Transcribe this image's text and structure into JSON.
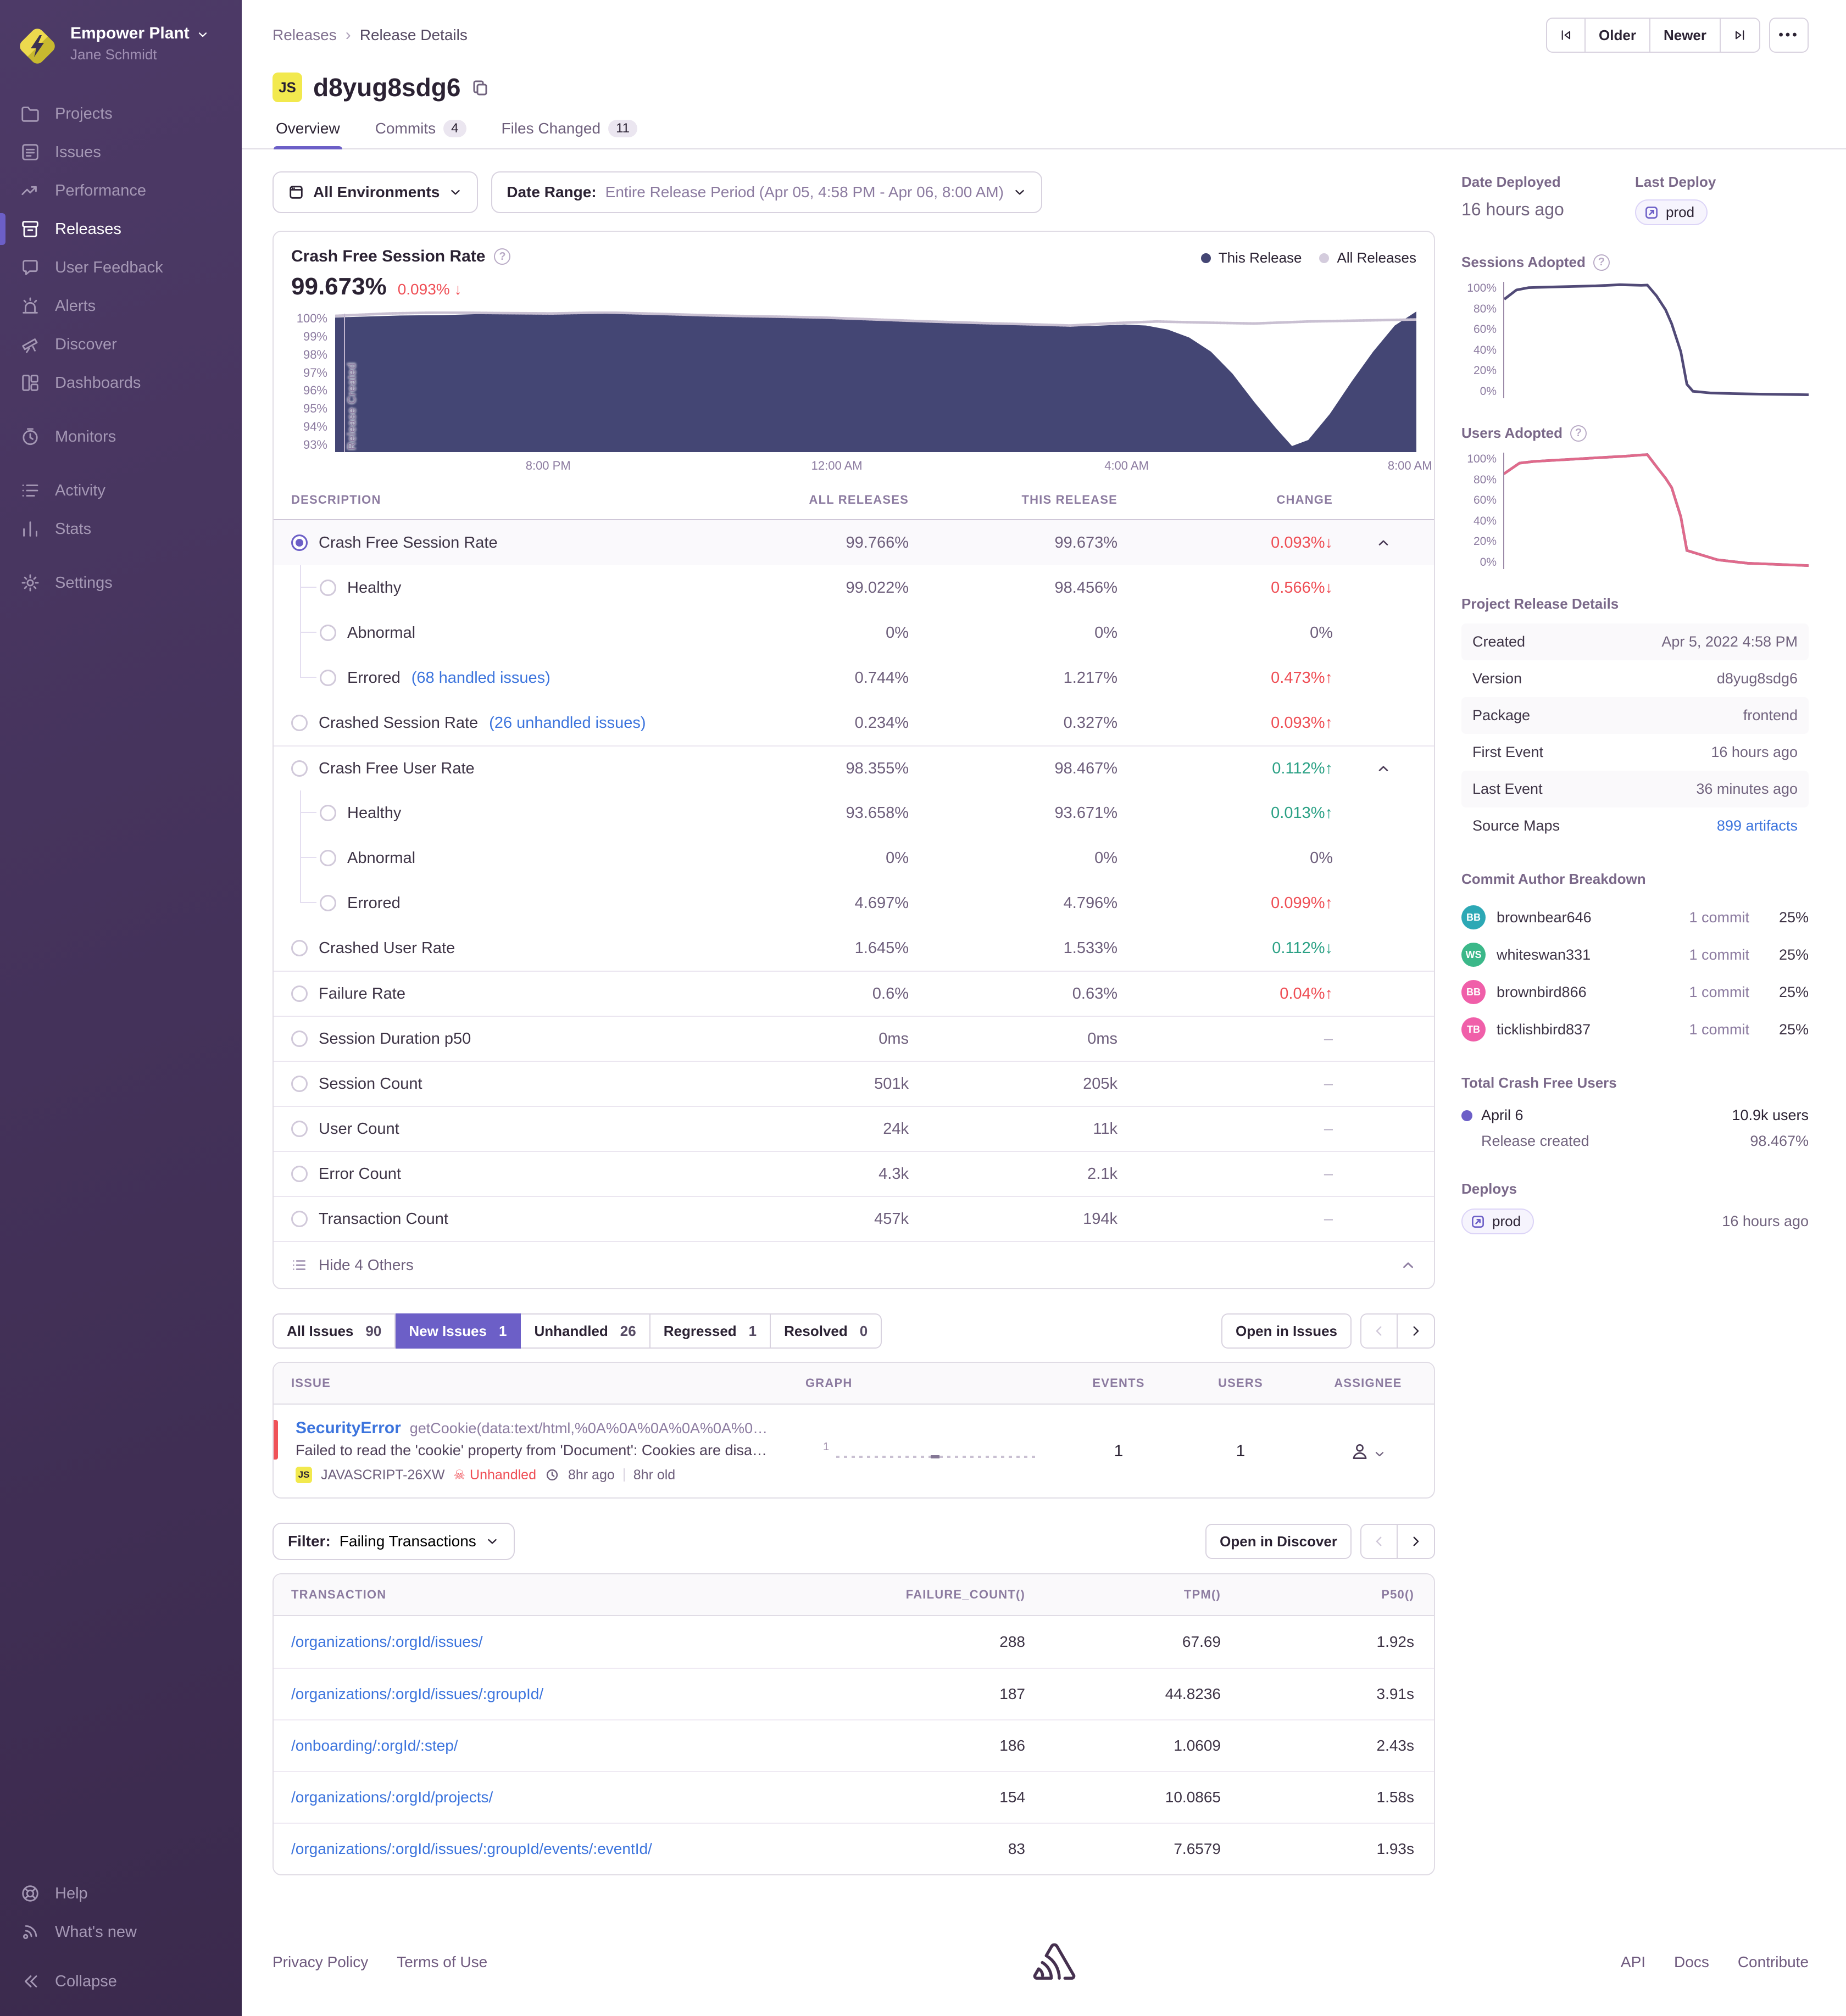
{
  "colors": {
    "accent": "#6C5FC7",
    "link": "#3C74DD",
    "bad": "#EF4E55",
    "good": "#2BA185",
    "area": "#444674",
    "dotted": "#D4CCDD"
  },
  "sidebar": {
    "org_name": "Empower Plant",
    "user_name": "Jane Schmidt",
    "items": [
      {
        "label": "Projects",
        "icon": "projects"
      },
      {
        "label": "Issues",
        "icon": "issues"
      },
      {
        "label": "Performance",
        "icon": "performance"
      },
      {
        "label": "Releases",
        "icon": "releases",
        "active": true
      },
      {
        "label": "User Feedback",
        "icon": "user-feedback"
      },
      {
        "label": "Alerts",
        "icon": "alerts"
      },
      {
        "label": "Discover",
        "icon": "discover"
      },
      {
        "label": "Dashboards",
        "icon": "dashboards"
      },
      {
        "label": "Monitors",
        "icon": "monitors",
        "gap": true
      },
      {
        "label": "Activity",
        "icon": "activity",
        "gap": true
      },
      {
        "label": "Stats",
        "icon": "stats"
      },
      {
        "label": "Settings",
        "icon": "settings",
        "gap": true
      }
    ],
    "footer_items": [
      {
        "label": "Help",
        "icon": "help"
      },
      {
        "label": "What's new",
        "icon": "whats-new"
      },
      {
        "label": "Collapse",
        "icon": "collapse"
      }
    ]
  },
  "header": {
    "breadcrumb": [
      "Releases",
      "Release Details"
    ],
    "older": "Older",
    "newer": "Newer",
    "more": "•••",
    "project_badge": "JS",
    "title": "d8yug8sdg6",
    "tabs": [
      {
        "label": "Overview",
        "active": true
      },
      {
        "label": "Commits",
        "count": "4"
      },
      {
        "label": "Files Changed",
        "count": "11"
      }
    ]
  },
  "filters": {
    "environments": "All Environments",
    "date_label": "Date Range:",
    "date_value": "Entire Release Period (Apr 05, 4:58 PM - Apr 06, 8:00 AM)"
  },
  "chart": {
    "title": "Crash Free Session Rate",
    "value": "99.673%",
    "change": "0.093% ↓",
    "annotation": "Release Created",
    "legend": [
      {
        "label": "This Release"
      },
      {
        "label": "All Releases"
      }
    ]
  },
  "charts": {
    "crash_free_sessions": {
      "type": "area",
      "ylim": [
        93,
        100
      ],
      "y_ticks": [
        "100%",
        "99%",
        "98%",
        "97%",
        "96%",
        "95%",
        "94%",
        "93%"
      ],
      "x_ticks": [
        {
          "label": "8:00 PM",
          "pos": 0.197
        },
        {
          "label": "12:00 AM",
          "pos": 0.464
        },
        {
          "label": "4:00 AM",
          "pos": 0.732
        },
        {
          "label": "8:00 AM",
          "pos": 0.994
        }
      ],
      "series": [
        {
          "name": "This Release",
          "style": "area",
          "color": "#444674",
          "points": [
            [
              0,
              99.7
            ],
            [
              0.03,
              99.75
            ],
            [
              0.06,
              99.8
            ],
            [
              0.1,
              99.82
            ],
            [
              0.14,
              99.88
            ],
            [
              0.18,
              99.86
            ],
            [
              0.22,
              99.92
            ],
            [
              0.26,
              99.95
            ],
            [
              0.3,
              99.9
            ],
            [
              0.34,
              99.85
            ],
            [
              0.38,
              99.8
            ],
            [
              0.42,
              99.78
            ],
            [
              0.46,
              99.7
            ],
            [
              0.5,
              99.6
            ],
            [
              0.54,
              99.52
            ],
            [
              0.58,
              99.45
            ],
            [
              0.62,
              99.38
            ],
            [
              0.66,
              99.32
            ],
            [
              0.7,
              99.28
            ],
            [
              0.73,
              99.35
            ],
            [
              0.75,
              99.3
            ],
            [
              0.77,
              99.1
            ],
            [
              0.79,
              98.7
            ],
            [
              0.81,
              98.0
            ],
            [
              0.83,
              96.9
            ],
            [
              0.85,
              95.5
            ],
            [
              0.87,
              94.2
            ],
            [
              0.885,
              93.3
            ],
            [
              0.9,
              93.6
            ],
            [
              0.92,
              94.9
            ],
            [
              0.94,
              96.5
            ],
            [
              0.96,
              98.0
            ],
            [
              0.98,
              99.3
            ],
            [
              1,
              100
            ]
          ]
        },
        {
          "name": "All Releases",
          "style": "dotted",
          "color": "#C9C0D2",
          "points": [
            [
              0,
              99.78
            ],
            [
              0.05,
              99.9
            ],
            [
              0.1,
              99.95
            ],
            [
              0.15,
              99.92
            ],
            [
              0.2,
              99.9
            ],
            [
              0.25,
              99.95
            ],
            [
              0.3,
              99.88
            ],
            [
              0.35,
              99.8
            ],
            [
              0.4,
              99.75
            ],
            [
              0.45,
              99.7
            ],
            [
              0.5,
              99.6
            ],
            [
              0.55,
              99.5
            ],
            [
              0.6,
              99.42
            ],
            [
              0.65,
              99.35
            ],
            [
              0.68,
              99.3
            ],
            [
              0.72,
              99.42
            ],
            [
              0.76,
              99.5
            ],
            [
              0.8,
              99.45
            ],
            [
              0.85,
              99.4
            ],
            [
              0.9,
              99.5
            ],
            [
              0.95,
              99.55
            ],
            [
              1,
              99.6
            ]
          ]
        }
      ]
    },
    "sessions_adopted": {
      "type": "line",
      "ylim": [
        0,
        100
      ],
      "y_ticks": [
        "100%",
        "80%",
        "60%",
        "40%",
        "20%",
        "0%"
      ],
      "series": [
        {
          "name": "Sessions Adopted",
          "style": "line",
          "color": "#514A77",
          "points": [
            [
              0,
              85
            ],
            [
              0.04,
              93
            ],
            [
              0.08,
              95
            ],
            [
              0.15,
              95.5
            ],
            [
              0.22,
              96
            ],
            [
              0.3,
              96.5
            ],
            [
              0.38,
              97.5
            ],
            [
              0.45,
              97
            ],
            [
              0.47,
              97.2
            ],
            [
              0.5,
              88
            ],
            [
              0.53,
              76
            ],
            [
              0.55,
              64
            ],
            [
              0.58,
              40
            ],
            [
              0.6,
              12
            ],
            [
              0.62,
              6
            ],
            [
              0.68,
              4.5
            ],
            [
              0.75,
              4
            ],
            [
              0.85,
              3.5
            ],
            [
              1,
              3
            ]
          ]
        }
      ]
    },
    "users_adopted": {
      "type": "line",
      "ylim": [
        0,
        100
      ],
      "y_ticks": [
        "100%",
        "80%",
        "60%",
        "40%",
        "20%",
        "0%"
      ],
      "series": [
        {
          "name": "Users Adopted",
          "style": "line",
          "color": "#6F5A86",
          "points": [
            [
              0,
              82
            ],
            [
              0.05,
              91
            ],
            [
              0.1,
              92.5
            ],
            [
              0.2,
              94
            ],
            [
              0.3,
              95.5
            ],
            [
              0.4,
              97
            ],
            [
              0.45,
              98
            ],
            [
              0.47,
              98.3
            ],
            [
              0.5,
              88
            ],
            [
              0.53,
              78
            ],
            [
              0.55,
              70
            ],
            [
              0.58,
              45
            ],
            [
              0.6,
              16
            ],
            [
              0.65,
              12
            ],
            [
              0.7,
              8
            ],
            [
              0.8,
              5
            ],
            [
              0.9,
              4
            ],
            [
              1,
              3
            ]
          ]
        },
        {
          "name": "Users Adopted overlay",
          "style": "dotted",
          "color": "#E06A8B",
          "points": [
            [
              0,
              82
            ],
            [
              0.05,
              91
            ],
            [
              0.1,
              92.5
            ],
            [
              0.2,
              94
            ],
            [
              0.3,
              95.5
            ],
            [
              0.4,
              97
            ],
            [
              0.45,
              98
            ],
            [
              0.47,
              98.3
            ],
            [
              0.5,
              88
            ],
            [
              0.53,
              78
            ],
            [
              0.55,
              70
            ],
            [
              0.58,
              45
            ],
            [
              0.6,
              16
            ],
            [
              0.65,
              12
            ],
            [
              0.7,
              8
            ],
            [
              0.8,
              5
            ],
            [
              0.9,
              4
            ],
            [
              1,
              3
            ]
          ]
        }
      ]
    }
  },
  "metrics": {
    "columns": [
      "DESCRIPTION",
      "ALL RELEASES",
      "THIS RELEASE",
      "CHANGE"
    ],
    "collapse_label": "Hide 4 Others",
    "rows": [
      {
        "name": "Crash Free Session Rate",
        "all": "99.766%",
        "this": "99.673%",
        "change": "0.093%",
        "arrow": "↓",
        "tone": "bad",
        "selected": true,
        "chevron": true
      },
      {
        "name": "Healthy",
        "all": "99.022%",
        "this": "98.456%",
        "change": "0.566%",
        "arrow": "↓",
        "tone": "bad",
        "child": true,
        "cont": true
      },
      {
        "name": "Abnormal",
        "all": "0%",
        "this": "0%",
        "change": "0%",
        "arrow": "",
        "tone": "plain",
        "child": true,
        "cont": true
      },
      {
        "name": "Errored",
        "link": "(68 handled issues)",
        "all": "0.744%",
        "this": "1.217%",
        "change": "0.473%",
        "arrow": "↑",
        "tone": "bad",
        "child": true
      },
      {
        "name": "Crashed Session Rate",
        "link": "(26 unhandled issues)",
        "all": "0.234%",
        "this": "0.327%",
        "change": "0.093%",
        "arrow": "↑",
        "tone": "bad"
      },
      {
        "name": "Crash Free User Rate",
        "all": "98.355%",
        "this": "98.467%",
        "change": "0.112%",
        "arrow": "↑",
        "tone": "good",
        "divider": true,
        "chevron": true
      },
      {
        "name": "Healthy",
        "all": "93.658%",
        "this": "93.671%",
        "change": "0.013%",
        "arrow": "↑",
        "tone": "good",
        "child": true,
        "cont": true
      },
      {
        "name": "Abnormal",
        "all": "0%",
        "this": "0%",
        "change": "0%",
        "arrow": "",
        "tone": "plain",
        "child": true,
        "cont": true
      },
      {
        "name": "Errored",
        "all": "4.697%",
        "this": "4.796%",
        "change": "0.099%",
        "arrow": "↑",
        "tone": "bad",
        "child": true
      },
      {
        "name": "Crashed User Rate",
        "all": "1.645%",
        "this": "1.533%",
        "change": "0.112%",
        "arrow": "↓",
        "tone": "good"
      },
      {
        "name": "Failure Rate",
        "all": "0.6%",
        "this": "0.63%",
        "change": "0.04%",
        "arrow": "↑",
        "tone": "bad",
        "divider": true
      },
      {
        "name": "Session Duration p50",
        "all": "0ms",
        "this": "0ms",
        "change": "–",
        "arrow": "",
        "tone": "muted",
        "divider": true
      },
      {
        "name": "Session Count",
        "all": "501k",
        "this": "205k",
        "change": "–",
        "arrow": "",
        "tone": "muted",
        "divider": true
      },
      {
        "name": "User Count",
        "all": "24k",
        "this": "11k",
        "change": "–",
        "arrow": "",
        "tone": "muted",
        "divider": true
      },
      {
        "name": "Error Count",
        "all": "4.3k",
        "this": "2.1k",
        "change": "–",
        "arrow": "",
        "tone": "muted",
        "divider": true
      },
      {
        "name": "Transaction Count",
        "all": "457k",
        "this": "194k",
        "change": "–",
        "arrow": "",
        "tone": "muted",
        "divider": true
      }
    ]
  },
  "issues": {
    "tabs": [
      {
        "label": "All Issues",
        "count": "90"
      },
      {
        "label": "New Issues",
        "count": "1",
        "active": true
      },
      {
        "label": "Unhandled",
        "count": "26"
      },
      {
        "label": "Regressed",
        "count": "1"
      },
      {
        "label": "Resolved",
        "count": "0"
      }
    ],
    "open_label": "Open in Issues",
    "columns": [
      "ISSUE",
      "GRAPH",
      "EVENTS",
      "USERS",
      "ASSIGNEE"
    ],
    "row": {
      "title": "SecurityError",
      "subtitle": "getCookie(data:text/html,%0A%0A%0A%0A%0A%0…",
      "message": "Failed to read the 'cookie' property from 'Document': Cookies are disa…",
      "badge": "JS",
      "short_id": "JAVASCRIPT-26XW",
      "unhandled": "Unhandled",
      "age": "8hr ago",
      "old": "8hr old",
      "graph_label": "1",
      "events": "1",
      "users": "1"
    }
  },
  "transactions": {
    "filter_label": "Filter:",
    "filter_value": "Failing Transactions",
    "open_label": "Open in Discover",
    "columns": [
      "TRANSACTION",
      "FAILURE_COUNT()",
      "TPM()",
      "P50()"
    ],
    "rows": [
      {
        "path": "/organizations/:orgId/issues/",
        "count": "288",
        "tpm": "67.69",
        "p50": "1.92s"
      },
      {
        "path": "/organizations/:orgId/issues/:groupId/",
        "count": "187",
        "tpm": "44.8236",
        "p50": "3.91s"
      },
      {
        "path": "/onboarding/:orgId/:step/",
        "count": "186",
        "tpm": "1.0609",
        "p50": "2.43s"
      },
      {
        "path": "/organizations/:orgId/projects/",
        "count": "154",
        "tpm": "10.0865",
        "p50": "1.58s"
      },
      {
        "path": "/organizations/:orgId/issues/:groupId/events/:eventId/",
        "count": "83",
        "tpm": "7.6579",
        "p50": "1.93s"
      }
    ]
  },
  "aside": {
    "date_deployed_label": "Date Deployed",
    "date_deployed": "16 hours ago",
    "last_deploy_label": "Last Deploy",
    "deploy_env": "prod",
    "sessions_title": "Sessions Adopted",
    "users_title": "Users Adopted",
    "details_title": "Project Release Details",
    "details": [
      {
        "label": "Created",
        "value": "Apr 5, 2022 4:58 PM"
      },
      {
        "label": "Version",
        "value": "d8yug8sdg6"
      },
      {
        "label": "Package",
        "value": "frontend"
      },
      {
        "label": "First Event",
        "value": "16 hours ago"
      },
      {
        "label": "Last Event",
        "value": "36 minutes ago"
      },
      {
        "label": "Source Maps",
        "value": "899 artifacts",
        "link": true
      }
    ],
    "commits_title": "Commit Author Breakdown",
    "authors": [
      {
        "initials": "BB",
        "name": "brownbear646",
        "commits": "1 commit",
        "pct": "25%",
        "color": "#2CA8B5"
      },
      {
        "initials": "WS",
        "name": "whiteswan331",
        "commits": "1 commit",
        "pct": "25%",
        "color": "#3BB889"
      },
      {
        "initials": "BB",
        "name": "brownbird866",
        "commits": "1 commit",
        "pct": "25%",
        "color": "#F05FA9"
      },
      {
        "initials": "TB",
        "name": "ticklishbird837",
        "commits": "1 commit",
        "pct": "25%",
        "color": "#F05FA9"
      }
    ],
    "crash_free_title": "Total Crash Free Users",
    "crash_free_rows": [
      {
        "label": "April 6",
        "value": "10.9k users",
        "dot": true
      },
      {
        "label": "Release created",
        "value": "98.467%",
        "muted": true
      }
    ],
    "deploys_title": "Deploys",
    "deploy_time": "16 hours ago"
  },
  "footer": {
    "left": [
      "Privacy Policy",
      "Terms of Use"
    ],
    "right": [
      "API",
      "Docs",
      "Contribute"
    ]
  }
}
